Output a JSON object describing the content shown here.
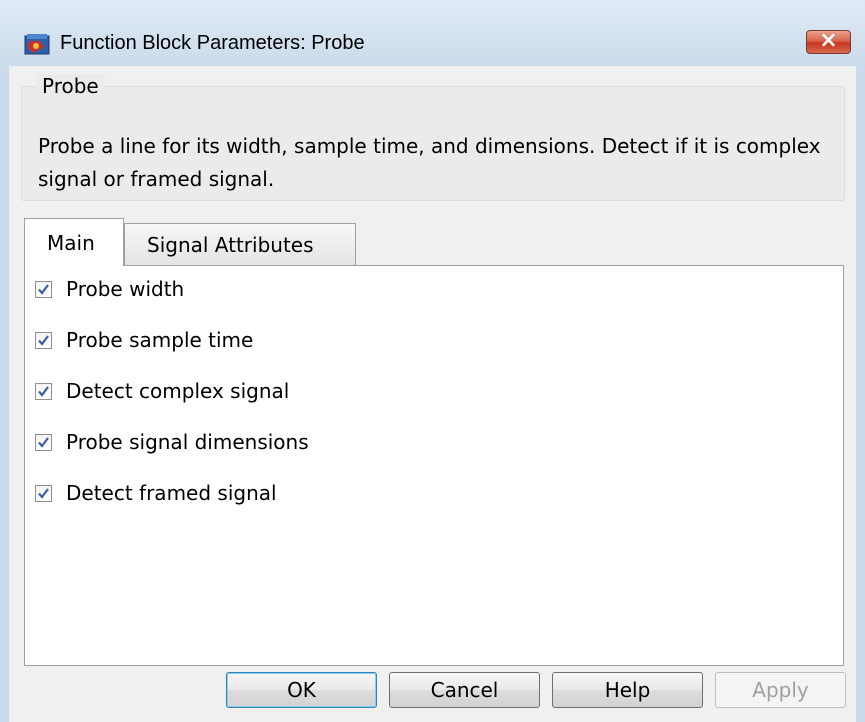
{
  "window": {
    "title": "Function Block Parameters: Probe",
    "close_label": "×"
  },
  "group": {
    "title": "Probe",
    "description": "Probe a line for its width, sample time, and dimensions. Detect if it is complex signal or framed signal."
  },
  "tabs": [
    {
      "label": "Main",
      "selected": true
    },
    {
      "label": "Signal Attributes",
      "selected": false
    }
  ],
  "options": [
    {
      "label": "Probe width",
      "checked": true
    },
    {
      "label": "Probe sample time",
      "checked": true
    },
    {
      "label": "Detect complex signal",
      "checked": true
    },
    {
      "label": "Probe signal dimensions",
      "checked": true
    },
    {
      "label": "Detect framed signal",
      "checked": true
    }
  ],
  "buttons": {
    "ok": "OK",
    "cancel": "Cancel",
    "help": "Help",
    "apply": "Apply"
  },
  "colors": {
    "window_frame": "#c9daea",
    "close_button": "#c4381f",
    "checkmark": "#3a5fa0"
  },
  "icons": {
    "app": "simulink-block-icon",
    "close": "close-icon",
    "check": "checkmark-icon"
  }
}
